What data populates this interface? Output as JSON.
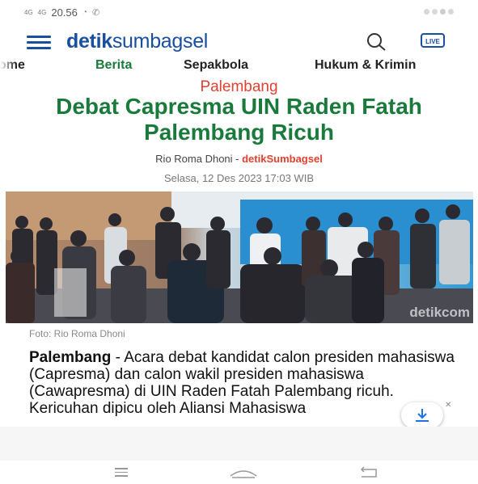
{
  "status_bar": {
    "network_left": "4G",
    "network_right": "4G",
    "time": "20.56",
    "icons": [
      "signal-icon",
      "phone-icon"
    ]
  },
  "app_bar": {
    "logo_bold": "detik",
    "logo_light": "sumbagsel",
    "live_label": "LIVE"
  },
  "nav": {
    "items": [
      "Home",
      "Berita",
      "Sepakbola",
      "Hukum & Kriminal"
    ],
    "active": "Berita",
    "rendered": [
      "ome",
      "Berita",
      "Sepakbola",
      "Hukum & Krimin"
    ]
  },
  "article": {
    "kicker": "Palembang",
    "headline": "Debat Capresma UIN Raden Fatah Palembang Ricuh",
    "author": "Rio Roma Dhoni",
    "byline_sep": " - ",
    "source": "detikSumbagsel",
    "date": "Selasa, 12 Des 2023 17:03 WIB",
    "photo_watermark": "detikcom",
    "caption": "Foto: Rio Roma Dhoni",
    "lead_place": "Palembang",
    "lead_text": " - Acara debat kandidat calon presiden mahasiswa (Capresma) dan calon wakil presiden mahasiswa (Cawapresma) di UIN Raden Fatah Palembang ricuh. Kericuhan dipicu oleh Aliansi Mahasiswa"
  },
  "colors": {
    "brand_blue": "#1a4fa0",
    "headline_green": "#1a7a3c",
    "accent_red": "#e0412f"
  }
}
